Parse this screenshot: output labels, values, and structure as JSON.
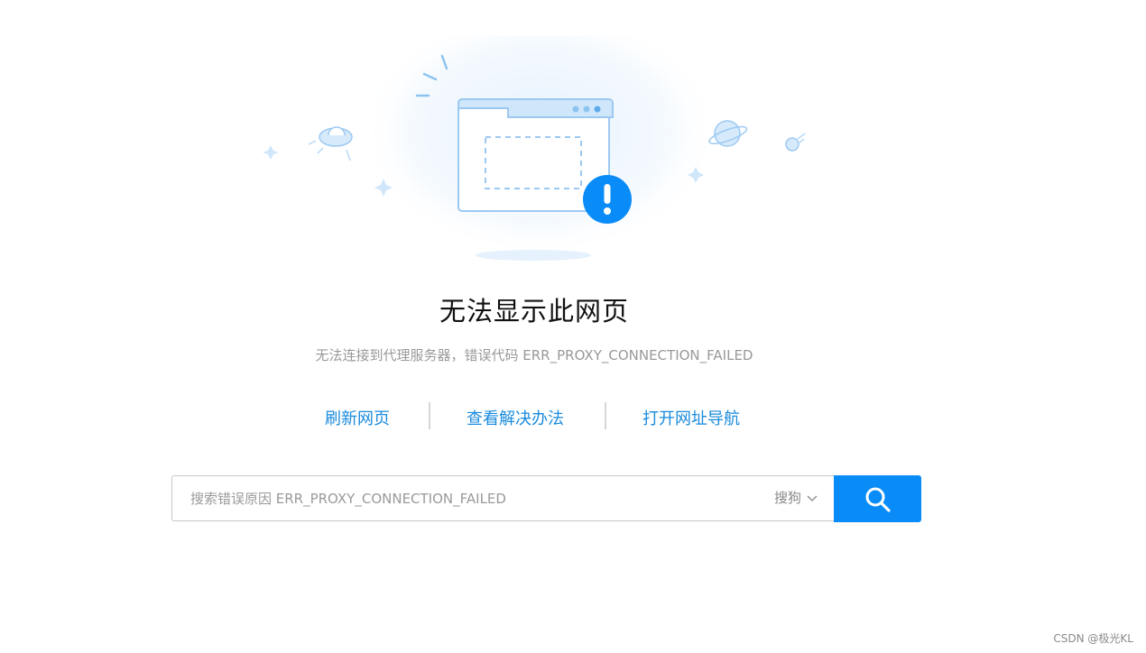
{
  "error_page": {
    "title": "无法显示此网页",
    "subtitle": "无法连接到代理服务器，错误代码 ERR_PROXY_CONNECTION_FAILED"
  },
  "actions": [
    {
      "label": "刷新网页"
    },
    {
      "label": "查看解决办法"
    },
    {
      "label": "打开网址导航"
    }
  ],
  "search": {
    "placeholder": "搜索错误原因 ERR_PROXY_CONNECTION_FAILED",
    "engine": "搜狗",
    "button_icon": "search-icon"
  },
  "watermark": "CSDN @极光KL",
  "colors": {
    "accent": "#0a8cf8",
    "link": "#1a8bdc",
    "illustration_light": "#cfe6fb",
    "illustration_stroke": "#9cc9f2"
  }
}
